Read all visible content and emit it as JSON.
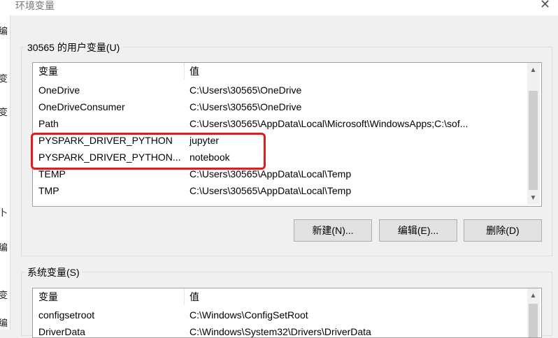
{
  "window": {
    "title": "环境变量",
    "close_glyph": "✕"
  },
  "background_window": {
    "chars": [
      "编",
      "变",
      "变",
      "卜",
      "编",
      "变",
      "编"
    ]
  },
  "user_vars": {
    "group_label": "30565 的用户变量(U)",
    "columns": [
      "变量",
      "值"
    ],
    "rows": [
      {
        "name": "OneDrive",
        "value": "C:\\Users\\30565\\OneDrive"
      },
      {
        "name": "OneDriveConsumer",
        "value": "C:\\Users\\30565\\OneDrive"
      },
      {
        "name": "Path",
        "value": "C:\\Users\\30565\\AppData\\Local\\Microsoft\\WindowsApps;C:\\sof..."
      },
      {
        "name": "PYSPARK_DRIVER_PYTHON",
        "value": "jupyter"
      },
      {
        "name": "PYSPARK_DRIVER_PYTHON...",
        "value": "notebook"
      },
      {
        "name": "TEMP",
        "value": "C:\\Users\\30565\\AppData\\Local\\Temp"
      },
      {
        "name": "TMP",
        "value": "C:\\Users\\30565\\AppData\\Local\\Temp"
      }
    ],
    "buttons": {
      "new": "新建(N)...",
      "edit": "编辑(E)...",
      "delete": "删除(D)"
    }
  },
  "system_vars": {
    "group_label": "系统变量(S)",
    "columns": [
      "变量",
      "值"
    ],
    "rows": [
      {
        "name": "configsetroot",
        "value": "C:\\Windows\\ConfigSetRoot"
      },
      {
        "name": "DriverData",
        "value": "C:\\Windows\\System32\\Drivers\\DriverData"
      }
    ]
  },
  "scroll_arrows": {
    "up": "▲",
    "down": "▼"
  },
  "colors": {
    "highlight": "#e21b1b",
    "background": "#f0f0f0",
    "list_background": "#ffffff"
  }
}
